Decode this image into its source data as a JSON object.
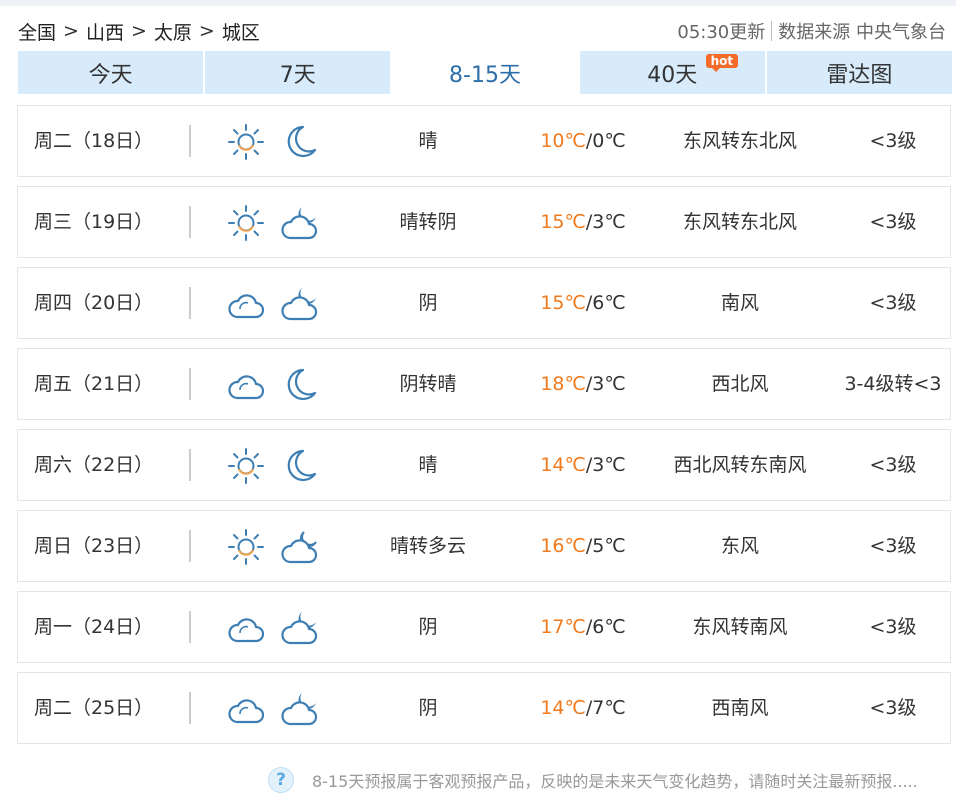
{
  "breadcrumb": {
    "items": [
      "全国",
      "山西",
      "太原",
      "城区"
    ],
    "separator": ">"
  },
  "source": {
    "update_time": "05:30更新",
    "source_text": "数据来源 中央气象台"
  },
  "tabs": [
    {
      "label": "今天",
      "active": false
    },
    {
      "label": "7天",
      "active": false
    },
    {
      "label": "8-15天",
      "active": true
    },
    {
      "label": "40天",
      "active": false,
      "badge": "hot"
    },
    {
      "label": "雷达图",
      "active": false
    }
  ],
  "forecast": [
    {
      "date": "周二（18日）",
      "day_icon": "sun",
      "night_icon": "moon",
      "weather": "晴",
      "high": "10℃",
      "low": "/0℃",
      "wind": "东风转东北风",
      "level": "<3级"
    },
    {
      "date": "周三（19日）",
      "day_icon": "sun",
      "night_icon": "cloud-moon",
      "weather": "晴转阴",
      "high": "15℃",
      "low": "/3℃",
      "wind": "东风转东北风",
      "level": "<3级"
    },
    {
      "date": "周四（20日）",
      "day_icon": "cloud",
      "night_icon": "cloud-moon",
      "weather": "阴",
      "high": "15℃",
      "low": "/6℃",
      "wind": "南风",
      "level": "<3级"
    },
    {
      "date": "周五（21日）",
      "day_icon": "cloud",
      "night_icon": "moon",
      "weather": "阴转晴",
      "high": "18℃",
      "low": "/3℃",
      "wind": "西北风",
      "level": "3-4级转<3"
    },
    {
      "date": "周六（22日）",
      "day_icon": "sun",
      "night_icon": "moon",
      "weather": "晴",
      "high": "14℃",
      "low": "/3℃",
      "wind": "西北风转东南风",
      "level": "<3级"
    },
    {
      "date": "周日（23日）",
      "day_icon": "sun",
      "night_icon": "cloud-moon-light",
      "weather": "晴转多云",
      "high": "16℃",
      "low": "/5℃",
      "wind": "东风",
      "level": "<3级"
    },
    {
      "date": "周一（24日）",
      "day_icon": "cloud",
      "night_icon": "cloud-moon",
      "weather": "阴",
      "high": "17℃",
      "low": "/6℃",
      "wind": "东风转南风",
      "level": "<3级"
    },
    {
      "date": "周二（25日）",
      "day_icon": "cloud",
      "night_icon": "cloud-moon",
      "weather": "阴",
      "high": "14℃",
      "low": "/7℃",
      "wind": "西南风",
      "level": "<3级"
    }
  ],
  "footer": {
    "icon": "question-icon",
    "note": "8-15天预报属于客观预报产品，反映的是未来天气变化趋势，请随时关注最新预报....."
  },
  "colors": {
    "tab_bg": "#d8ebfb",
    "active_tab_text": "#2b6ea8",
    "high_temp": "#f07a1c",
    "icon_stroke": "#3d7fb4"
  }
}
